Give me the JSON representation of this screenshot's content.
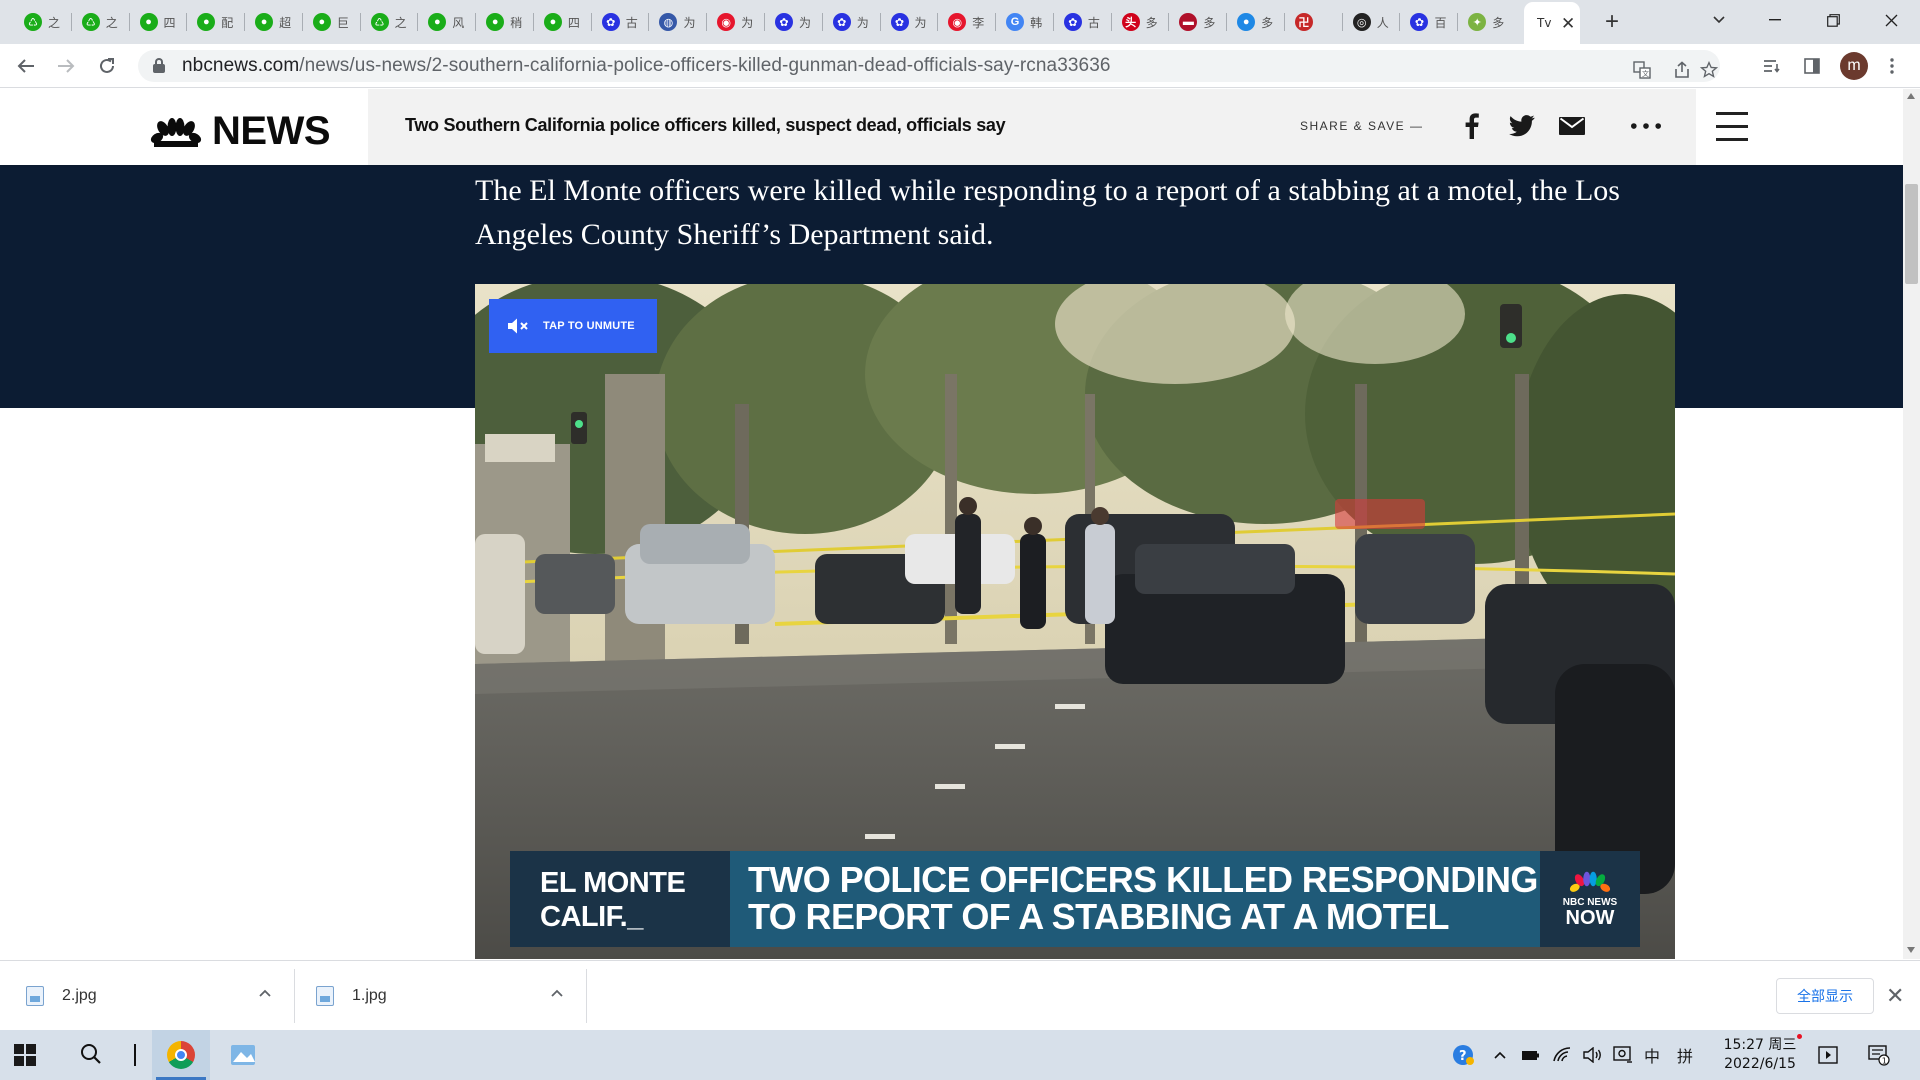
{
  "browser": {
    "tabs": [
      {
        "favicon": "recycle-icon",
        "color": "#1aad19",
        "text": "之"
      },
      {
        "favicon": "recycle-icon",
        "color": "#1aad19",
        "text": "之"
      },
      {
        "favicon": "wechat-icon",
        "color": "#1aad19",
        "text": "四"
      },
      {
        "favicon": "wechat-icon",
        "color": "#1aad19",
        "text": "配"
      },
      {
        "favicon": "wechat-icon",
        "color": "#1aad19",
        "text": "超"
      },
      {
        "favicon": "wechat-icon",
        "color": "#1aad19",
        "text": "巨"
      },
      {
        "favicon": "recycle-icon",
        "color": "#1aad19",
        "text": "之"
      },
      {
        "favicon": "wechat-icon",
        "color": "#1aad19",
        "text": "风"
      },
      {
        "favicon": "wechat-icon",
        "color": "#1aad19",
        "text": "稍"
      },
      {
        "favicon": "wechat-icon",
        "color": "#1aad19",
        "text": "四"
      },
      {
        "favicon": "baidu-paw-icon",
        "color": "#2932e1",
        "text": "古"
      },
      {
        "favicon": "globe-icon",
        "color": "#3558a8",
        "text": "为"
      },
      {
        "favicon": "weibo-icon",
        "color": "#e6162d",
        "text": "为"
      },
      {
        "favicon": "baidu-paw-icon",
        "color": "#2932e1",
        "text": "为"
      },
      {
        "favicon": "baidu-paw-icon",
        "color": "#2932e1",
        "text": "为"
      },
      {
        "favicon": "baidu-paw-icon",
        "color": "#2932e1",
        "text": "为"
      },
      {
        "favicon": "weibo-icon",
        "color": "#e6162d",
        "text": "李"
      },
      {
        "favicon": "google-icon",
        "color": "#4285f4",
        "text": "韩"
      },
      {
        "favicon": "baidu-paw-icon",
        "color": "#2932e1",
        "text": "古"
      },
      {
        "favicon": "toutiao-icon",
        "color": "#d0021b",
        "text": "多"
      },
      {
        "favicon": "flag-icon",
        "color": "#b0102a",
        "text": "多"
      },
      {
        "favicon": "bubble-icon",
        "color": "#1e88e5",
        "text": "多"
      },
      {
        "favicon": "seal-icon",
        "color": "#c62828",
        "text": ""
      },
      {
        "favicon": "target-icon",
        "color": "#222222",
        "text": "人"
      },
      {
        "favicon": "baidu-paw-icon",
        "color": "#2932e1",
        "text": "百"
      },
      {
        "favicon": "pin-icon",
        "color": "#7cb342",
        "text": "多"
      }
    ],
    "active_tab": {
      "text": "Tv",
      "close": "✕"
    },
    "new_tab": "+",
    "window_controls": {
      "dropdown": "⌄",
      "minimize": "—",
      "restore": "❐",
      "close": "✕"
    },
    "url": {
      "host": "nbcnews.com",
      "path": "/news/us-news/2-southern-california-police-officers-killed-gunman-dead-officials-say-rcna33636"
    },
    "profile_initial": "m"
  },
  "site": {
    "logo_text": "NEWS",
    "header_title": "Two Southern California police officers killed, suspect dead, officials say",
    "share_label": "SHARE & SAVE —",
    "dek": "The El Monte officers were killed while responding to a report of a stabbing at a motel, the Los Angeles County Sheriff’s Department said."
  },
  "video": {
    "unmute_label": "TAP TO UNMUTE",
    "location_line1": "EL MONTE",
    "location_line2": "CALIF._",
    "headline_line1": "TWO POLICE OFFICERS KILLED RESPONDING",
    "headline_line2": "TO REPORT OF A STABBING AT A MOTEL",
    "logo_line1": "NBC NEWS",
    "logo_line2": "NOW"
  },
  "downloads": {
    "items": [
      {
        "name": "2.jpg"
      },
      {
        "name": "1.jpg"
      }
    ],
    "show_all": "全部显示",
    "close": "✕"
  },
  "taskbar": {
    "clock_time": "15:27 周三",
    "clock_date": "2022/6/15",
    "ime_lang": "中",
    "ime_mode": "拼"
  }
}
